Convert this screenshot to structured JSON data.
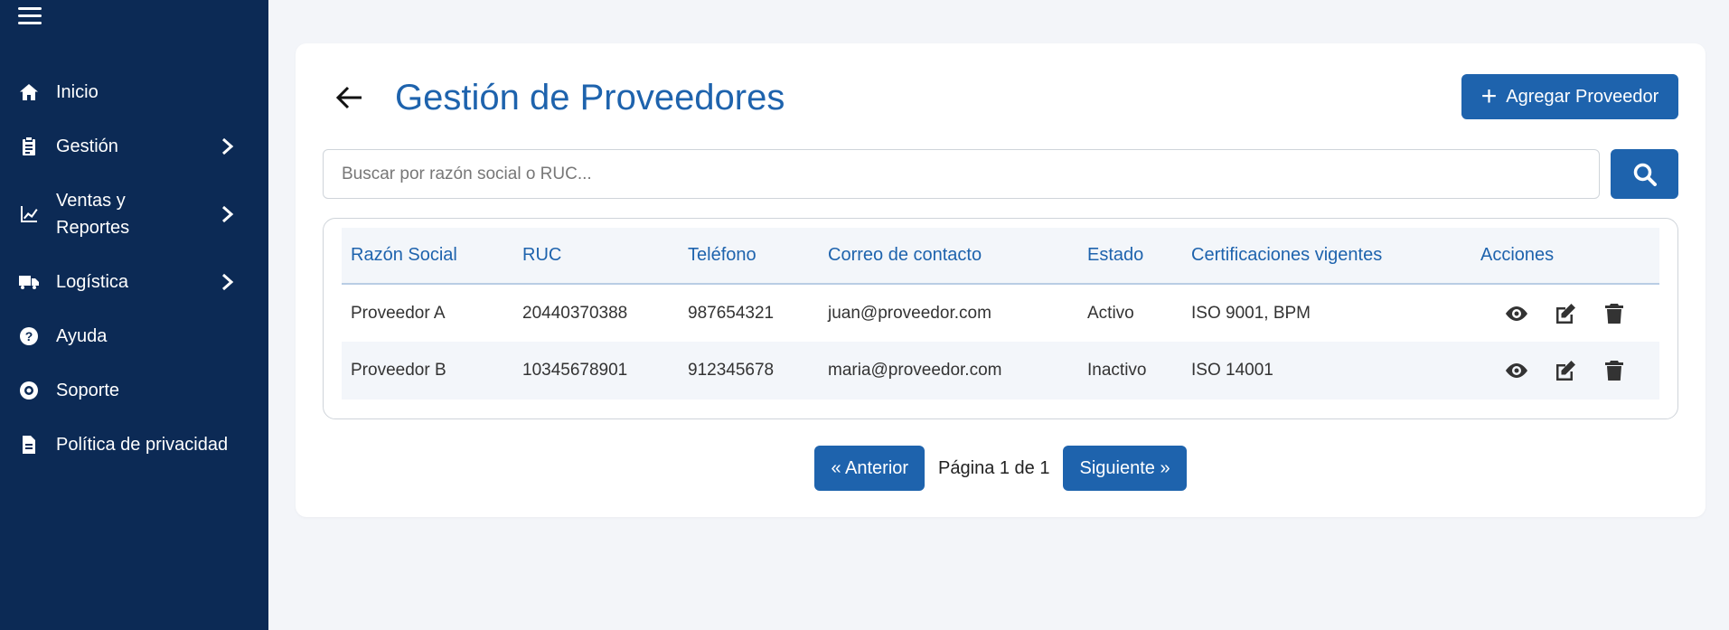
{
  "sidebar": {
    "items": [
      {
        "label": "Inicio",
        "icon": "home-icon",
        "has_submenu": false
      },
      {
        "label": "Gestión",
        "icon": "clipboard-icon",
        "has_submenu": true
      },
      {
        "label": "Ventas y\nReportes",
        "icon": "chart-line-icon",
        "has_submenu": true
      },
      {
        "label": "Logística",
        "icon": "truck-icon",
        "has_submenu": true
      },
      {
        "label": "Ayuda",
        "icon": "help-icon",
        "has_submenu": false
      },
      {
        "label": "Soporte",
        "icon": "lifebuoy-icon",
        "has_submenu": false
      },
      {
        "label": "Política de privacidad",
        "icon": "document-icon",
        "has_submenu": false
      }
    ]
  },
  "header": {
    "title": "Gestión de Proveedores",
    "add_label": "Agregar Proveedor"
  },
  "search": {
    "placeholder": "Buscar por razón social o RUC...",
    "value": ""
  },
  "table": {
    "columns": [
      "Razón Social",
      "RUC",
      "Teléfono",
      "Correo de contacto",
      "Estado",
      "Certificaciones vigentes",
      "Acciones"
    ],
    "rows": [
      {
        "razon_social": "Proveedor A",
        "ruc": "20440370388",
        "telefono": "987654321",
        "correo": "juan@proveedor.com",
        "estado": "Activo",
        "certificaciones": "ISO 9001, BPM"
      },
      {
        "razon_social": "Proveedor B",
        "ruc": "10345678901",
        "telefono": "912345678",
        "correo": "maria@proveedor.com",
        "estado": "Inactivo",
        "certificaciones": "ISO 14001"
      }
    ]
  },
  "pagination": {
    "prev_label": "« Anterior",
    "page_text": "Página 1 de 1",
    "next_label": "Siguiente »"
  },
  "colors": {
    "sidebar_bg": "#0c2a55",
    "accent": "#1e63ad",
    "page_bg": "#f3f5f9"
  }
}
